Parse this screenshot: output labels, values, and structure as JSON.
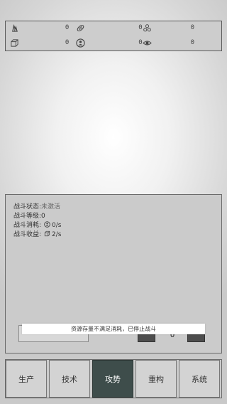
{
  "resources": [
    {
      "icon": "crystal-icon",
      "value": "0"
    },
    {
      "icon": "ring-icon",
      "value": "0"
    },
    {
      "icon": "atom-icon",
      "value": "0"
    },
    {
      "icon": "cube-icon",
      "value": "0"
    },
    {
      "icon": "worker-icon",
      "value": "0"
    },
    {
      "icon": "eye-icon",
      "value": "0"
    }
  ],
  "battle": {
    "status_label": "战斗状态:",
    "status_value": "未激活",
    "level_label": "战斗等级:",
    "level_value": "0",
    "cost_label": "战斗消耗:",
    "cost_value": "0/s",
    "gain_label": "战斗收益:",
    "gain_value": "2/s",
    "quantity": "0"
  },
  "toast": "资源存量不满足消耗，已停止战斗",
  "tabs": [
    {
      "label": "生产",
      "active": false
    },
    {
      "label": "技术",
      "active": false
    },
    {
      "label": "攻势",
      "active": true
    },
    {
      "label": "重构",
      "active": false
    },
    {
      "label": "系统",
      "active": false
    }
  ]
}
